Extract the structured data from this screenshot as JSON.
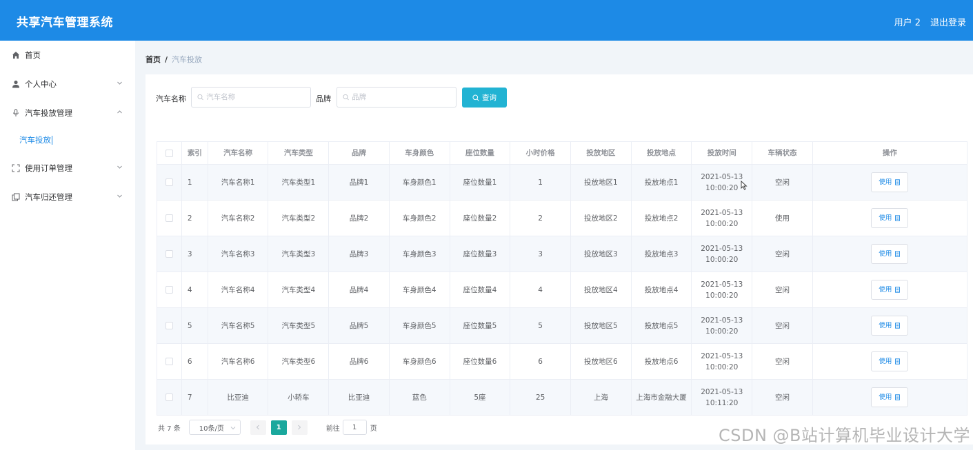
{
  "header": {
    "title": "共享汽车管理系统",
    "user": "用户 2",
    "logout": "退出登录"
  },
  "sidebar": {
    "items": [
      {
        "label": "首页",
        "icon": "home-icon"
      },
      {
        "label": "个人中心",
        "icon": "user-icon"
      },
      {
        "label": "汽车投放管理",
        "icon": "microphone-icon"
      },
      {
        "label": "使用订单管理",
        "icon": "fullscreen-icon"
      },
      {
        "label": "汽车归还管理",
        "icon": "copy-icon"
      }
    ],
    "active_sub": "汽车投放"
  },
  "breadcrumb": {
    "home": "首页",
    "separator": "/",
    "current": "汽车投放"
  },
  "search": {
    "name_label": "汽车名称",
    "name_placeholder": "汽车名称",
    "brand_label": "品牌",
    "brand_placeholder": "品牌",
    "button": "查询"
  },
  "table": {
    "headers": [
      "索引",
      "汽车名称",
      "汽车类型",
      "品牌",
      "车身颜色",
      "座位数量",
      "小时价格",
      "投放地区",
      "投放地点",
      "投放时间",
      "车辆状态",
      "操作"
    ],
    "rows": [
      [
        "1",
        "汽车名称1",
        "汽车类型1",
        "品牌1",
        "车身颜色1",
        "座位数量1",
        "1",
        "投放地区1",
        "投放地点1",
        "2021-05-13 10:00:20",
        "空闲"
      ],
      [
        "2",
        "汽车名称2",
        "汽车类型2",
        "品牌2",
        "车身颜色2",
        "座位数量2",
        "2",
        "投放地区2",
        "投放地点2",
        "2021-05-13 10:00:20",
        "使用"
      ],
      [
        "3",
        "汽车名称3",
        "汽车类型3",
        "品牌3",
        "车身颜色3",
        "座位数量3",
        "3",
        "投放地区3",
        "投放地点3",
        "2021-05-13 10:00:20",
        "空闲"
      ],
      [
        "4",
        "汽车名称4",
        "汽车类型4",
        "品牌4",
        "车身颜色4",
        "座位数量4",
        "4",
        "投放地区4",
        "投放地点4",
        "2021-05-13 10:00:20",
        "空闲"
      ],
      [
        "5",
        "汽车名称5",
        "汽车类型5",
        "品牌5",
        "车身颜色5",
        "座位数量5",
        "5",
        "投放地区5",
        "投放地点5",
        "2021-05-13 10:00:20",
        "空闲"
      ],
      [
        "6",
        "汽车名称6",
        "汽车类型6",
        "品牌6",
        "车身颜色6",
        "座位数量6",
        "6",
        "投放地区6",
        "投放地点6",
        "2021-05-13 10:00:20",
        "空闲"
      ],
      [
        "7",
        "比亚迪",
        "小轿车",
        "比亚迪",
        "蓝色",
        "5座",
        "25",
        "上海",
        "上海市金融大厦",
        "2021-05-13 10:11:20",
        "空闲"
      ]
    ],
    "action_label": "使用"
  },
  "pagination": {
    "total": "共 7 条",
    "page_size": "10条/页",
    "current_page": "1",
    "goto_label": "前往",
    "goto_value": "1",
    "page_suffix": "页"
  },
  "watermark": "CSDN @B站计算机毕业设计大学",
  "colors": {
    "header": "#1d8ae6",
    "query_button": "#22b3d3",
    "active_page": "#1aa89d"
  }
}
